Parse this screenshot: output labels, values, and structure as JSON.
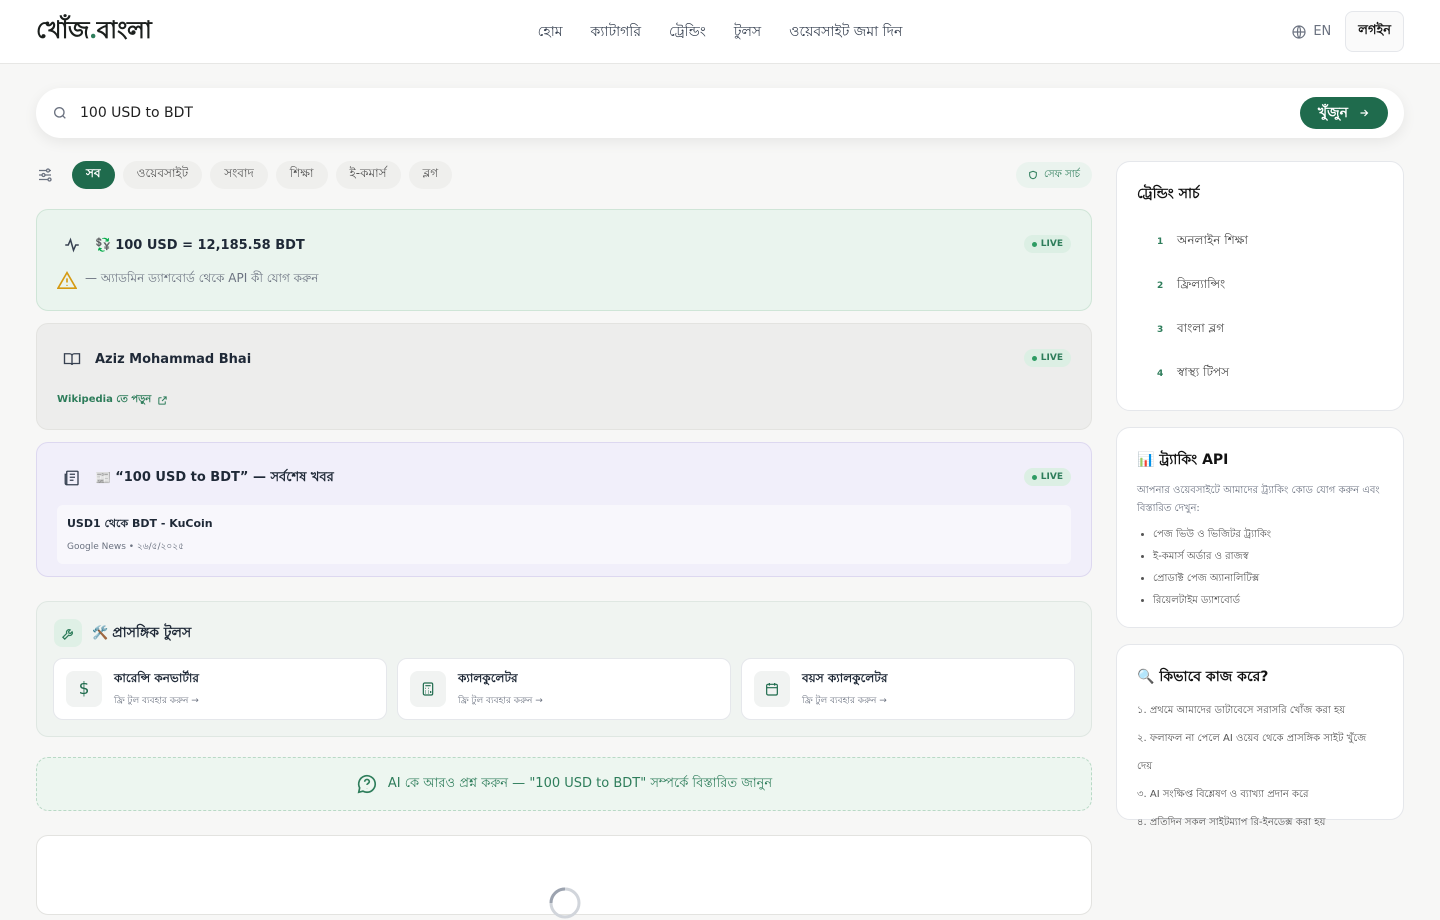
{
  "header": {
    "logo_main": "খোঁজ",
    "logo_dot": ".",
    "logo_tail": "বাংলা",
    "nav": [
      "হোম",
      "ক্যাটাগরি",
      "ট্রেন্ডিং",
      "টুলস",
      "ওয়েবসাইট জমা দিন"
    ],
    "lang": "EN",
    "login": "লগইন"
  },
  "search": {
    "query": "100 USD to BDT",
    "button": "খুঁজুন"
  },
  "filters": {
    "chips": [
      "সব",
      "ওয়েবসাইট",
      "সংবাদ",
      "শিক্ষা",
      "ই-কমার্স",
      "ব্লগ"
    ],
    "safe": "সেফ সার্চ"
  },
  "currency_card": {
    "emoji": "💱",
    "title": "100 USD = 12,185.58 BDT",
    "live": "LIVE",
    "warning": "— অ্যাডমিন ড্যাশবোর্ড থেকে API কী যোগ করুন"
  },
  "wiki_card": {
    "title": "Aziz Mohammad Bhai",
    "live": "LIVE",
    "link": "Wikipedia তে পড়ুন"
  },
  "news_card": {
    "emoji": "📰",
    "title": "“100 USD to BDT” — সর্বশেষ খবর",
    "live": "LIVE",
    "item_title": "USD1 থেকে BDT - KuCoin",
    "item_meta": "Google News • ২৬/৫/২০২৫"
  },
  "tools_card": {
    "emoji": "🛠️",
    "title": "প্রাসঙ্গিক টুলস",
    "tools": [
      {
        "name": "কারেন্সি কনভার্টার",
        "sub": "ফ্রি টুল ব্যবহার করুন →"
      },
      {
        "name": "ক্যালকুলেটর",
        "sub": "ফ্রি টুল ব্যবহার করুন →"
      },
      {
        "name": "বয়স ক্যালকুলেটর",
        "sub": "ফ্রি টুল ব্যবহার করুন →"
      }
    ]
  },
  "ask_ai": "AI কে আরও প্রশ্ন করুন — \"100 USD to BDT\" সম্পর্কে বিস্তারিত জানুন",
  "sidebar": {
    "trending": {
      "title": "ট্রেন্ডিং সার্চ",
      "items": [
        {
          "n": "1",
          "t": "অনলাইন শিক্ষা"
        },
        {
          "n": "2",
          "t": "ফ্রিল্যান্সিং"
        },
        {
          "n": "3",
          "t": "বাংলা ব্লগ"
        },
        {
          "n": "4",
          "t": "স্বাস্থ্য টিপস"
        }
      ]
    },
    "tracking": {
      "emoji": "📊",
      "title": "ট্র্যাকিং API",
      "desc": "আপনার ওয়েবসাইটে আমাদের ট্র্যাকিং কোড যোগ করুন এবং বিস্তারিত দেখুন:",
      "bullets": [
        "পেজ ভিউ ও ভিজিটর ট্র্যাকিং",
        "ই-কমার্স অর্ডার ও রাজস্ব",
        "প্রোডাক্ট পেজ অ্যানালিটিক্স",
        "রিয়েলটাইম ড্যাশবোর্ড"
      ]
    },
    "how": {
      "emoji": "🔍",
      "title": "কিভাবে কাজ করে?",
      "steps": [
        "১. প্রথমে আমাদের ডাটাবেসে সরাসরি খোঁজ করা হয়",
        "২. ফলাফল না পেলে AI ওয়েব থেকে প্রাসঙ্গিক সাইট খুঁজে দেয়",
        "৩. AI সংক্ষিপ্ত বিশ্লেষণ ও ব্যাখ্যা প্রদান করে",
        "৪. প্রতিদিন সকল সাইটম্যাপ রি-ইনডেক্স করা হয়"
      ]
    }
  }
}
